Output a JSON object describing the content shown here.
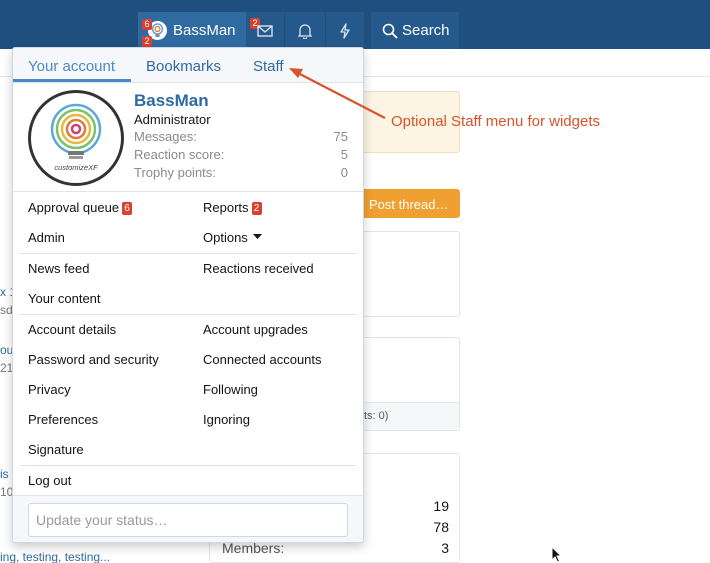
{
  "nav": {
    "username": "BassMan",
    "avatar_badge_top": "6",
    "avatar_badge_bottom": "2",
    "inbox_badge": "2",
    "search_label": "Search"
  },
  "background": {
    "post_thread_label": "Post thread…",
    "block_footer_fragment": "ts: 0)",
    "left_fragments": [
      "x 1",
      "sda",
      "ou",
      "21",
      "is",
      "10",
      "ing, testing, testing..."
    ],
    "stats": [
      {
        "label": "",
        "value": "19"
      },
      {
        "label": "",
        "value": "78"
      },
      {
        "label": "Members:",
        "value": "3"
      }
    ]
  },
  "menu": {
    "tabs": [
      {
        "label": "Your account",
        "active": true
      },
      {
        "label": "Bookmarks",
        "active": false
      },
      {
        "label": "Staff",
        "active": false
      }
    ],
    "profile": {
      "username": "BassMan",
      "title": "Administrator",
      "avatar_caption": "customizeXF",
      "stats": [
        {
          "label": "Messages:",
          "value": "75"
        },
        {
          "label": "Reaction score:",
          "value": "5"
        },
        {
          "label": "Trophy points:",
          "value": "0"
        }
      ]
    },
    "staff_links": {
      "approval_queue": "Approval queue",
      "approval_badge": "6",
      "reports": "Reports",
      "reports_badge": "2",
      "admin": "Admin",
      "options": "Options"
    },
    "activity_links": {
      "news_feed": "News feed",
      "reactions_received": "Reactions received",
      "your_content": "Your content"
    },
    "account_links": {
      "account_details": "Account details",
      "account_upgrades": "Account upgrades",
      "password_security": "Password and security",
      "connected_accounts": "Connected accounts",
      "privacy": "Privacy",
      "following": "Following",
      "preferences": "Preferences",
      "ignoring": "Ignoring",
      "signature": "Signature"
    },
    "logout": "Log out",
    "status_placeholder": "Update your status…"
  },
  "annotation": {
    "text": "Optional Staff menu for widgets",
    "color": "#d9532a"
  },
  "colors": {
    "header_bg": "#1e4f7f",
    "accent": "#2f6aa1",
    "badge": "#d9412f",
    "post_thread": "#f0a030"
  }
}
